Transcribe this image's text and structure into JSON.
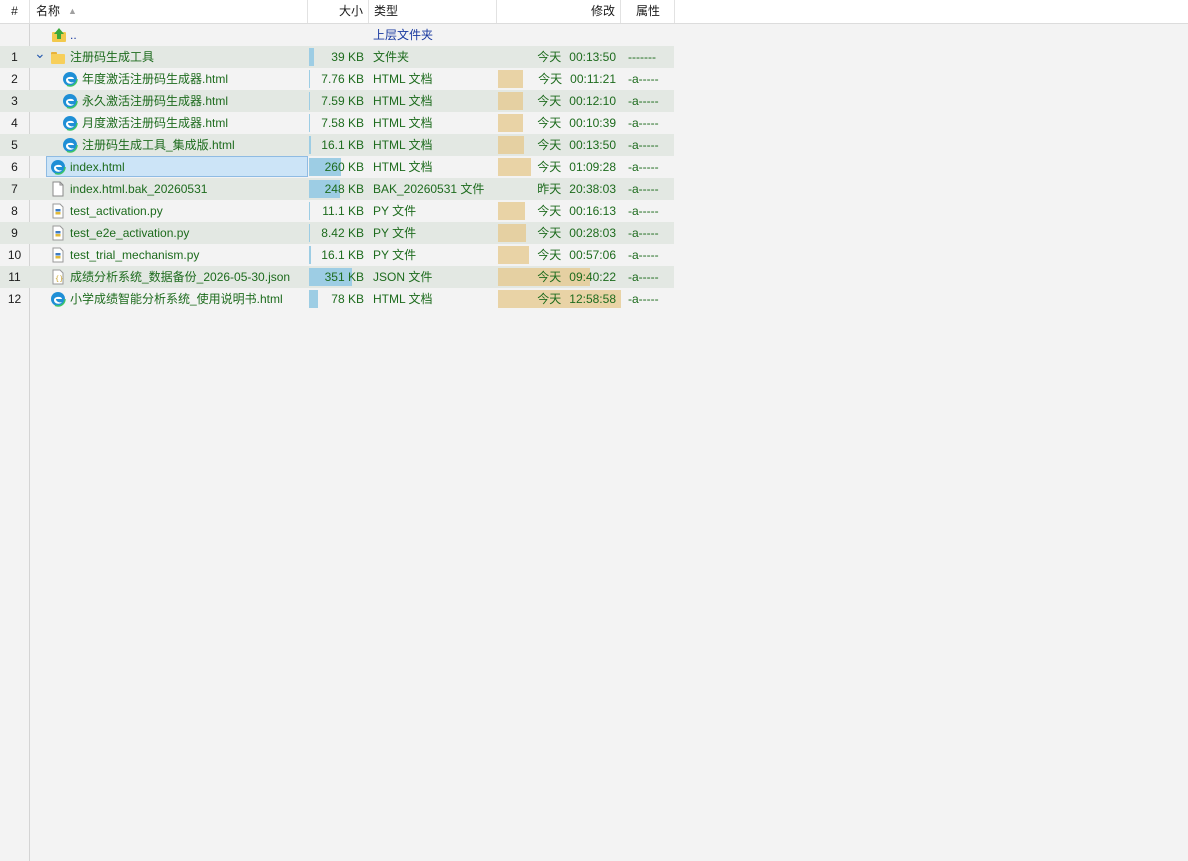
{
  "columns": {
    "num": "#",
    "name": "名称",
    "size": "大小",
    "type": "类型",
    "modified": "修改",
    "attrs": "属性"
  },
  "parent": {
    "name": "..",
    "type": "上层文件夹"
  },
  "rows": [
    {
      "num": "1",
      "name": "注册码生成工具",
      "icon": "folder-icon",
      "indent": 0,
      "expanded": true,
      "size": "39 KB",
      "size_ratio": 0.11,
      "type": "文件夹",
      "day": "今天",
      "time": "00:13:50",
      "mod_ratio": 0,
      "attrs": "-------"
    },
    {
      "num": "2",
      "name": "年度激活注册码生成器.html",
      "icon": "edge-icon",
      "indent": 1,
      "size": "7.76 KB",
      "size_ratio": 0.02,
      "type": "HTML 文档",
      "day": "今天",
      "time": "00:11:21",
      "mod_ratio": 0.2,
      "attrs": "-a-----"
    },
    {
      "num": "3",
      "name": "永久激活注册码生成器.html",
      "icon": "edge-icon",
      "indent": 1,
      "size": "7.59 KB",
      "size_ratio": 0.02,
      "type": "HTML 文档",
      "day": "今天",
      "time": "00:12:10",
      "mod_ratio": 0.2,
      "attrs": "-a-----"
    },
    {
      "num": "4",
      "name": "月度激活注册码生成器.html",
      "icon": "edge-icon",
      "indent": 1,
      "size": "7.58 KB",
      "size_ratio": 0.02,
      "type": "HTML 文档",
      "day": "今天",
      "time": "00:10:39",
      "mod_ratio": 0.2,
      "attrs": "-a-----"
    },
    {
      "num": "5",
      "name": "注册码生成工具_集成版.html",
      "icon": "edge-icon",
      "indent": 1,
      "size": "16.1 KB",
      "size_ratio": 0.04,
      "type": "HTML 文档",
      "day": "今天",
      "time": "00:13:50",
      "mod_ratio": 0.21,
      "attrs": "-a-----"
    },
    {
      "num": "6",
      "name": "index.html",
      "icon": "edge-icon",
      "indent": 0,
      "selected": true,
      "size": "260 KB",
      "size_ratio": 0.74,
      "type": "HTML 文档",
      "day": "今天",
      "time": "01:09:28",
      "mod_ratio": 0.27,
      "attrs": "-a-----"
    },
    {
      "num": "7",
      "name": "index.html.bak_20260531",
      "icon": "file-icon",
      "indent": 0,
      "size": "248 KB",
      "size_ratio": 0.71,
      "type": "BAK_20260531 文件",
      "day": "昨天",
      "time": "20:38:03",
      "mod_ratio": 0,
      "attrs": "-a-----"
    },
    {
      "num": "8",
      "name": "test_activation.py",
      "icon": "python-file-icon",
      "indent": 0,
      "size": "11.1 KB",
      "size_ratio": 0.03,
      "type": "PY 文件",
      "day": "今天",
      "time": "00:16:13",
      "mod_ratio": 0.22,
      "attrs": "-a-----"
    },
    {
      "num": "9",
      "name": "test_e2e_activation.py",
      "icon": "python-file-icon",
      "indent": 0,
      "size": "8.42 KB",
      "size_ratio": 0.02,
      "type": "PY 文件",
      "day": "今天",
      "time": "00:28:03",
      "mod_ratio": 0.23,
      "attrs": "-a-----"
    },
    {
      "num": "10",
      "name": "test_trial_mechanism.py",
      "icon": "python-file-icon",
      "indent": 0,
      "size": "16.1 KB",
      "size_ratio": 0.04,
      "type": "PY 文件",
      "day": "今天",
      "time": "00:57:06",
      "mod_ratio": 0.25,
      "attrs": "-a-----"
    },
    {
      "num": "11",
      "name": "成绩分析系统_数据备份_2026-05-30.json",
      "icon": "json-file-icon",
      "indent": 0,
      "size": "351 KB",
      "size_ratio": 1.0,
      "type": "JSON 文件",
      "day": "今天",
      "time": "09:40:22",
      "mod_ratio": 0.75,
      "attrs": "-a-----"
    },
    {
      "num": "12",
      "name": "小学成绩智能分析系统_使用说明书.html",
      "icon": "edge-icon",
      "indent": 0,
      "size": "78 KB",
      "size_ratio": 0.22,
      "type": "HTML 文档",
      "day": "今天",
      "time": "12:58:58",
      "mod_ratio": 1.0,
      "attrs": "-a-----"
    }
  ],
  "colors": {
    "text_green": "#1d6b1d",
    "size_bar": "#9dcde4",
    "mod_bar": "#e5c88c",
    "selection": "#cce4f7"
  }
}
